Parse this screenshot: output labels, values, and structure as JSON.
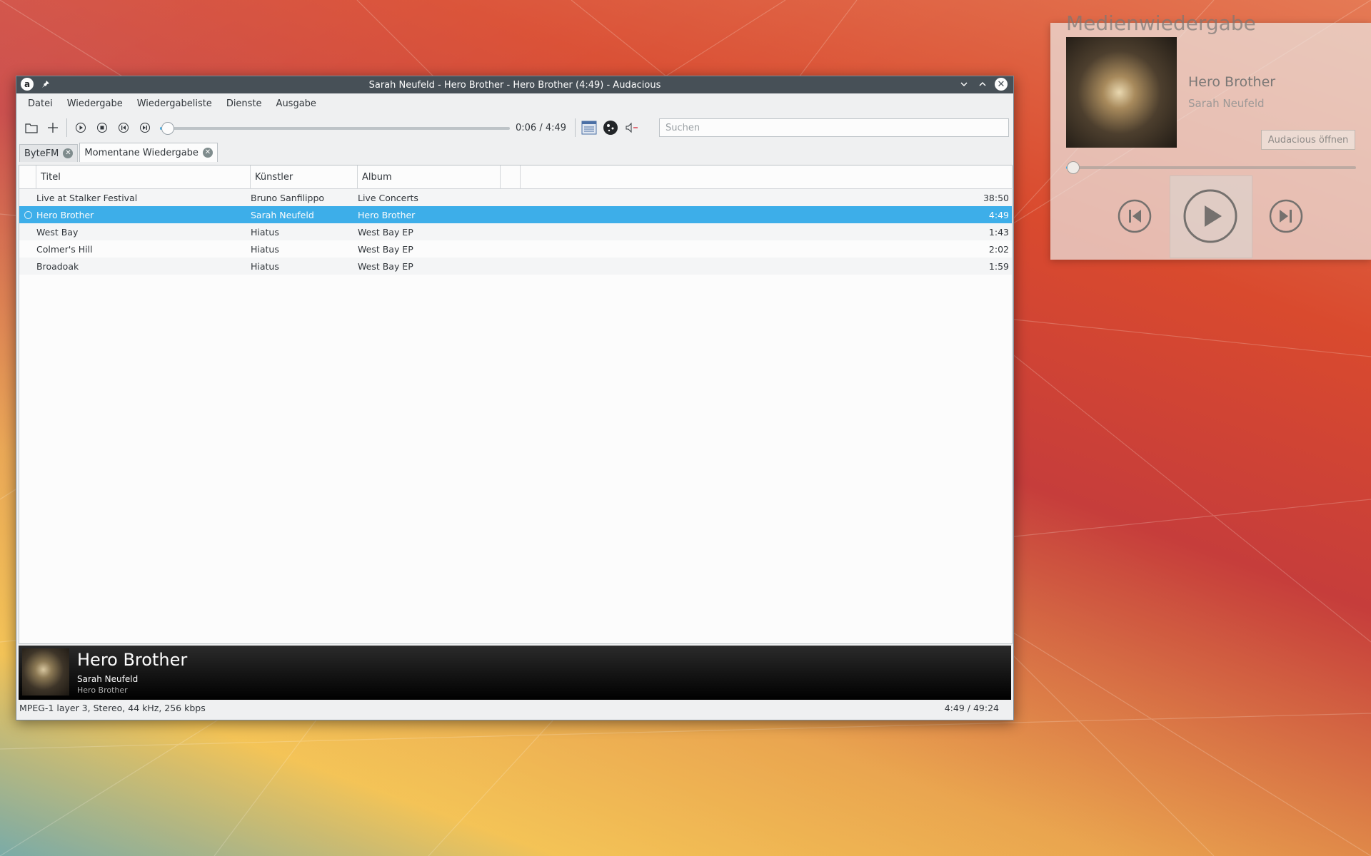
{
  "window": {
    "title": "Sarah Neufeld - Hero Brother - Hero Brother (4:49) - Audacious"
  },
  "menu": [
    "Datei",
    "Wiedergabe",
    "Wiedergabeliste",
    "Dienste",
    "Ausgabe"
  ],
  "toolbar": {
    "time": "0:06 / 4:49",
    "progress_fraction": 0.021,
    "search_placeholder": "Suchen"
  },
  "tabs": [
    {
      "label": "ByteFM",
      "active": false
    },
    {
      "label": "Momentane Wiedergabe",
      "active": true
    }
  ],
  "playlist": {
    "columns": [
      "Titel",
      "Künstler",
      "Album"
    ],
    "rows": [
      {
        "title": "Live at Stalker Festival",
        "artist": "Bruno Sanfilippo",
        "album": "Live Concerts",
        "length": "38:50",
        "selected": false
      },
      {
        "title": "Hero Brother",
        "artist": "Sarah Neufeld",
        "album": "Hero Brother",
        "length": "4:49",
        "selected": true
      },
      {
        "title": "West Bay",
        "artist": "Hiatus",
        "album": "West Bay EP",
        "length": "1:43",
        "selected": false
      },
      {
        "title": "Colmer's Hill",
        "artist": "Hiatus",
        "album": "West Bay EP",
        "length": "2:02",
        "selected": false
      },
      {
        "title": "Broadoak",
        "artist": "Hiatus",
        "album": "West Bay EP",
        "length": "1:59",
        "selected": false
      }
    ]
  },
  "now_playing": {
    "title": "Hero Brother",
    "artist": "Sarah Neufeld",
    "album": "Hero Brother"
  },
  "status": {
    "format": "MPEG-1 layer 3, Stereo, 44 kHz, 256 kbps",
    "total": "4:49 / 49:24"
  },
  "widget": {
    "header": "Medienwiedergabe",
    "title": "Hero Brother",
    "artist": "Sarah Neufeld",
    "open_label": "Audacious öffnen",
    "progress_fraction": 0.021
  },
  "colors": {
    "accent": "#3daee9",
    "titlebar": "#475057"
  }
}
